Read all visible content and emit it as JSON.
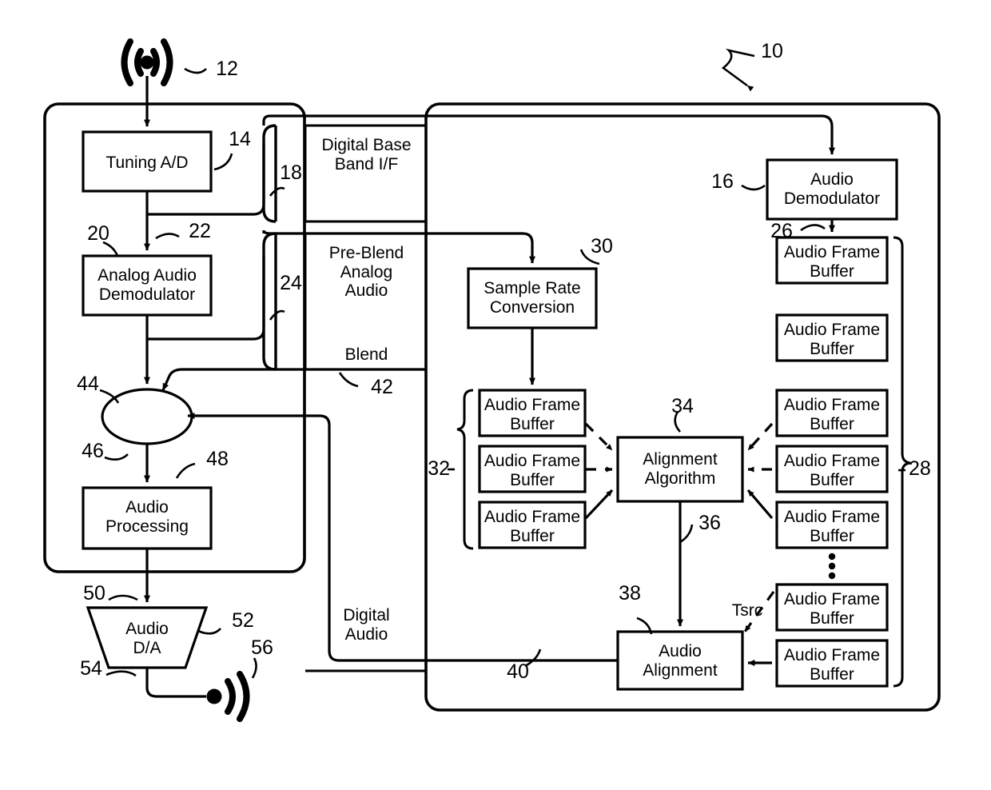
{
  "figure": {
    "type": "patent-block-diagram",
    "title": "Radio receiver audio blending block diagram",
    "overall_reference": "10"
  },
  "blocks": {
    "tuning_ad": "Tuning A/D",
    "analog_audio_demodulator": "Analog Audio\nDemodulator",
    "audio_processing": "Audio\nProcessing",
    "audio_da": "Audio\nD/A",
    "sample_rate_conversion": "Sample Rate\nConversion",
    "audio_demodulator": "Audio\nDemodulator",
    "alignment_algorithm": "Alignment\nAlgorithm",
    "audio_alignment": "Audio\nAlignment",
    "audio_frame_buffer": "Audio Frame\nBuffer"
  },
  "interface_labels": {
    "digital_base_band": "Digital Base\nBand I/F",
    "pre_blend_analog_audio": "Pre-Blend\nAnalog\nAudio",
    "blend": "Blend",
    "digital_audio": "Digital\nAudio"
  },
  "signal_labels": {
    "tsrc": "Tsrc"
  },
  "reference_numerals": {
    "antenna_in": "10",
    "rf_input": "12",
    "tuning_ad": "14",
    "audio_demodulator": "16",
    "digital_base_band_if": "18",
    "analog_audio_demodulator": "20",
    "tuned_signal": "22",
    "pre_blend_analog_if": "24",
    "demod_audio": "26",
    "digital_buffer_group": "28",
    "sample_rate_conversion": "30",
    "analog_buffer_group": "32",
    "alignment_algorithm": "34",
    "alignment_control": "36",
    "audio_alignment": "38",
    "digital_audio_path": "40",
    "blend_control": "42",
    "blend_node": "44",
    "blended_audio": "46",
    "audio_processing": "48",
    "processed_audio": "50",
    "audio_da": "52",
    "analog_out": "54",
    "speaker_out": "56"
  },
  "left_buffer_group": {
    "reference": "32",
    "count": 3,
    "labels": [
      "Audio Frame\nBuffer",
      "Audio Frame\nBuffer",
      "Audio Frame\nBuffer"
    ]
  },
  "right_buffer_group": {
    "reference": "28",
    "count": 7,
    "ellipsis": true,
    "labels": [
      "Audio Frame\nBuffer",
      "Audio Frame\nBuffer",
      "Audio Frame\nBuffer",
      "Audio Frame\nBuffer",
      "Audio Frame\nBuffer",
      "Audio Frame\nBuffer",
      "Audio Frame\nBuffer"
    ]
  },
  "colors": {
    "ink": "#000000",
    "paper": "#ffffff"
  }
}
